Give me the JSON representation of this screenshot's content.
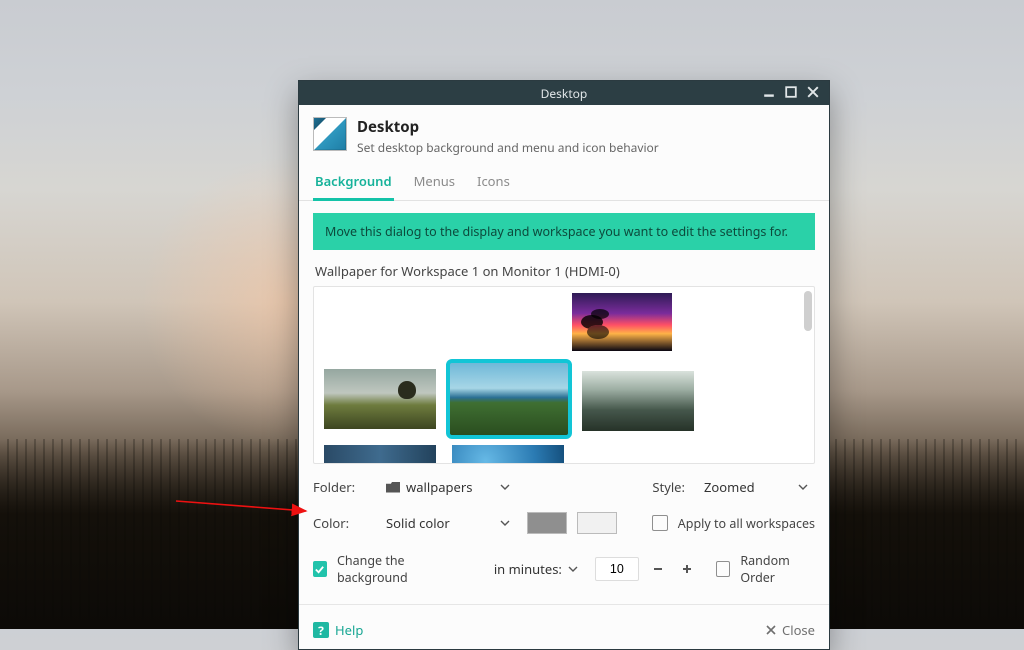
{
  "window": {
    "title": "Desktop"
  },
  "header": {
    "title": "Desktop",
    "subtitle": "Set desktop background and menu and icon behavior"
  },
  "tabs": [
    {
      "label": "Background",
      "active": true
    },
    {
      "label": "Menus",
      "active": false
    },
    {
      "label": "Icons",
      "active": false
    }
  ],
  "banner": "Move this dialog to the display and workspace you want to edit the settings for.",
  "wallpaper_section": "Wallpaper for Workspace 1 on Monitor 1 (HDMI-0)",
  "folder": {
    "label": "Folder:",
    "value": "wallpapers"
  },
  "style": {
    "label": "Style:",
    "value": "Zoomed"
  },
  "color": {
    "label": "Color:",
    "value": "Solid color"
  },
  "apply_all": {
    "label": "Apply to all workspaces",
    "checked": false
  },
  "change_bg": {
    "label": "Change the background",
    "checked": true
  },
  "interval_unit": "in minutes:",
  "interval_value": "10",
  "random": {
    "label": "Random Order",
    "checked": false
  },
  "footer": {
    "help": "Help",
    "close": "Close"
  }
}
